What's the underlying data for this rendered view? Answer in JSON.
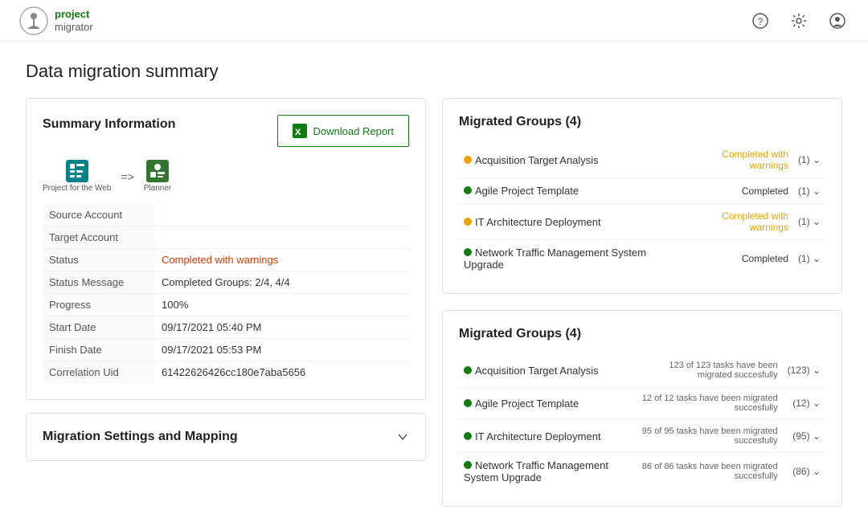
{
  "header": {
    "logo_text_line1": "project",
    "logo_text_line2": "migrator",
    "help_icon": "?",
    "settings_icon": "⚙",
    "account_icon": "👤"
  },
  "page": {
    "title": "Data migration summary"
  },
  "summary": {
    "title": "Summary Information",
    "download_button": "Download Report",
    "migration_from": "Project for the Web",
    "migration_arrow": "=>",
    "migration_to": "Planner",
    "fields": [
      {
        "label": "Source Account",
        "value": ""
      },
      {
        "label": "Target Account",
        "value": ""
      },
      {
        "label": "Status",
        "value": "Completed with warnings",
        "highlight": "warning"
      },
      {
        "label": "Status Message",
        "value": "Completed Groups: 2/4, 4/4"
      },
      {
        "label": "Progress",
        "value": "100%"
      },
      {
        "label": "Start Date",
        "value": "09/17/2021 05:40 PM"
      },
      {
        "label": "Finish Date",
        "value": "09/17/2021 05:53 PM"
      },
      {
        "label": "Correlation Uid",
        "value": "61422626426cc180e7aba5656"
      }
    ]
  },
  "settings": {
    "title": "Migration Settings and Mapping"
  },
  "migrated_groups_top": {
    "title": "Migrated Groups",
    "count": "(4)",
    "rows": [
      {
        "name": "Acquisition Target Analysis",
        "dot_color": "orange",
        "status": "Completed with warnings",
        "status_type": "warning",
        "count": "(1)"
      },
      {
        "name": "Agile Project Template",
        "dot_color": "green",
        "status": "Completed",
        "status_type": "normal",
        "count": "(1)"
      },
      {
        "name": "IT Architecture Deployment",
        "dot_color": "orange",
        "status": "Completed with warnings",
        "status_type": "warning",
        "count": "(1)"
      },
      {
        "name": "Network Traffic Management System Upgrade",
        "dot_color": "green",
        "status": "Completed",
        "status_type": "normal",
        "count": "(1)"
      }
    ]
  },
  "migrated_groups_bottom": {
    "title": "Migrated Groups",
    "count": "(4)",
    "rows": [
      {
        "name": "Acquisition Target Analysis",
        "dot_color": "green",
        "tasks_text": "123 of 123 tasks have been migrated succesfully",
        "count": "(123)"
      },
      {
        "name": "Agile Project Template",
        "dot_color": "green",
        "tasks_text": "12 of 12 tasks have been migrated succesfully",
        "count": "(12)"
      },
      {
        "name": "IT Architecture Deployment",
        "dot_color": "green",
        "tasks_text": "95 of 95 tasks have been migrated succesfully",
        "count": "(95)"
      },
      {
        "name": "Network Traffic Management System Upgrade",
        "dot_color": "green",
        "tasks_text": "86 of 86 tasks have been migrated succesfully",
        "count": "(86)"
      }
    ]
  }
}
